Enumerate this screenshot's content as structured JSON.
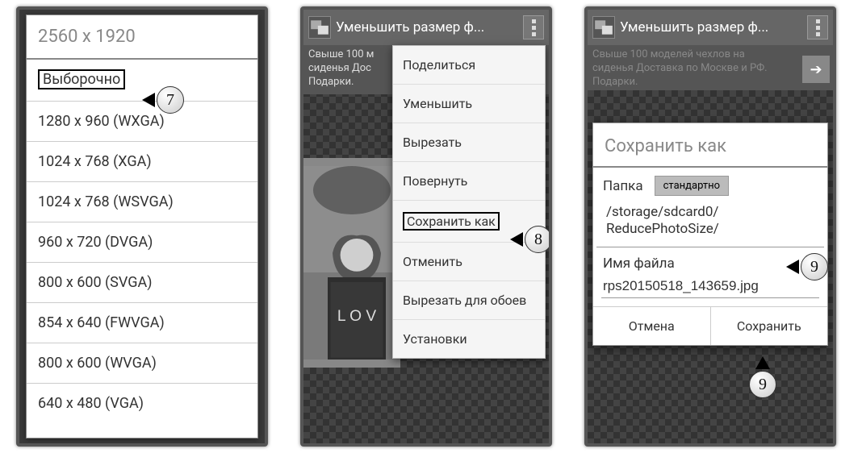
{
  "phone1": {
    "header": "2560 x 1920",
    "items": [
      "Выборочно",
      "1280 x 960 (WXGA)",
      "1024 x 768 (XGA)",
      "1024 x 768 (WSVGA)",
      "960 x 720 (DVGA)",
      "800 x 600 (SVGA)",
      "854 x 640 (FWVGA)",
      "800 x 600 (WVGA)",
      "640 x 480 (VGA)"
    ],
    "highlight_index": 0
  },
  "phone2": {
    "title": "Уменьшить размер ф...",
    "ad": "Свыше 100 м\nсиденья Дос\nПодарки.",
    "menu": [
      "Поделиться",
      "Уменьшить",
      "Вырезать",
      "Повернуть",
      "Сохранить как",
      "Отменить",
      "Вырезать для обоев",
      "Установки"
    ],
    "highlight_index": 4
  },
  "phone3": {
    "title": "Уменьшить размер ф...",
    "ad": "Свыше 100 моделей чехлов на\nсиденья Доставка по Москве и РФ.\nПодарки.",
    "dialog": {
      "title": "Сохранить как",
      "folder_label": "Папка",
      "standard_btn": "стандартно",
      "path": "/storage/sdcard0/\nReducePhotoSize/",
      "filename_label": "Имя файла",
      "filename_value": "rps20150518_143659.jpg",
      "cancel": "Отмена",
      "save": "Сохранить"
    }
  },
  "callouts": {
    "c7": "7",
    "c8": "8",
    "c9a": "9",
    "c9b": "9"
  }
}
